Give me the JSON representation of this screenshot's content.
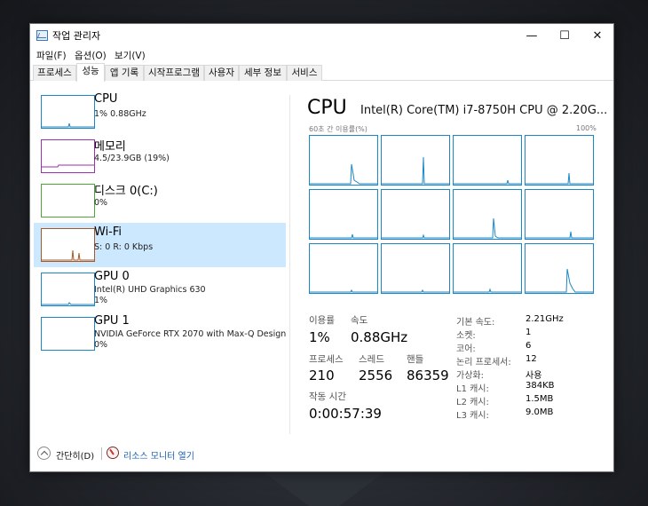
{
  "window": {
    "title": "작업 관리자"
  },
  "caption_buttons": {
    "minimize": "—",
    "maximize": "☐",
    "close": "✕"
  },
  "menu": [
    "파일(F)",
    "옵션(O)",
    "보기(V)"
  ],
  "tabs": [
    "프로세스",
    "성능",
    "앱 기록",
    "시작프로그램",
    "사용자",
    "세부 정보",
    "서비스"
  ],
  "active_tab": "성능",
  "resources": [
    {
      "name": "CPU",
      "sub1": "1% 0.88GHz",
      "sub2": "",
      "color": "#1b87c6"
    },
    {
      "name": "메모리",
      "sub1": "4.5/23.9GB (19%)",
      "sub2": "",
      "color": "#9b2fae",
      "fill_fraction": 0.19
    },
    {
      "name": "디스크 0(C:)",
      "sub1": "0%",
      "sub2": "",
      "color": "#4ca832"
    },
    {
      "name": "Wi-Fi",
      "sub1": "S: 0 R: 0 Kbps",
      "sub2": "",
      "color": "#a65a28"
    },
    {
      "name": "GPU 0",
      "sub1": "Intel(R) UHD Graphics 630",
      "sub2": "1%",
      "color": "#1b87c6"
    },
    {
      "name": "GPU 1",
      "sub1": "NVIDIA GeForce RTX 2070 with Max-Q Design",
      "sub2": "0%",
      "color": "#1b87c6"
    }
  ],
  "selected_resource": "Wi-Fi",
  "detail": {
    "title": "CPU",
    "model": "Intel(R) Core(TM) i7-8750H CPU @ 2.20G...",
    "axis_left": "60초 간 이용률(%)",
    "axis_right": "100%",
    "stats": {
      "usage_label": "이용률",
      "usage_value": "1%",
      "speed_label": "속도",
      "speed_value": "0.88GHz",
      "process_label": "프로세스",
      "process_value": "210",
      "thread_label": "스레드",
      "thread_value": "2556",
      "handle_label": "핸들",
      "handle_value": "86359",
      "uptime_label": "작동 시간",
      "uptime_value": "0:00:57:39"
    },
    "specs": [
      {
        "label": "기본 속도:",
        "value": "2.21GHz"
      },
      {
        "label": "소켓:",
        "value": "1"
      },
      {
        "label": "코어:",
        "value": "6"
      },
      {
        "label": "논리 프로세서:",
        "value": "12"
      },
      {
        "label": "가상화:",
        "value": "사용"
      },
      {
        "label": "L1 캐시:",
        "value": "384KB"
      },
      {
        "label": "L2 캐시:",
        "value": "1.5MB"
      },
      {
        "label": "L3 캐시:",
        "value": "9.0MB"
      }
    ]
  },
  "footer": {
    "collapse_label": "간단히(D)",
    "monitor_label": "리소스 모니터 열기"
  },
  "colors": {
    "accent": "#1b87c6",
    "selected_bg": "#cce8ff",
    "link": "#1a5fb4"
  }
}
